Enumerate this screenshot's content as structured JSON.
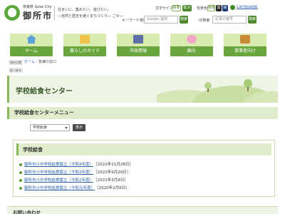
{
  "header": {
    "logo_sub": "奈良県 Gose City",
    "logo_city": "御所市",
    "tagline1": "住まいに、集めたい。遊びたい。",
    "tagline2": "―自然と歴史を継ぐまちづくり― ごせ―",
    "font_size_label": "文字サイズ",
    "font_size_standard": "標準",
    "font_size_large": "拡大",
    "bg_color_label": "背景色",
    "bg_standard": "標準",
    "bg_black": "黒",
    "bg_blue": "紺",
    "language": "Language",
    "keyword_search_label": "キーワード検索",
    "keyword_placeholder": "Google 提供",
    "keyword_search_button": "検索",
    "id_search_label": "ID検索",
    "id_placeholder": "記事の番号",
    "id_search_button": "検索"
  },
  "nav": {
    "items": [
      {
        "label": "ホーム",
        "icon": "home-icon"
      },
      {
        "label": "暮らしのガイド",
        "icon": "guide-icon"
      },
      {
        "label": "市政情報",
        "icon": "city-hall-icon"
      },
      {
        "label": "観光",
        "icon": "flower-icon"
      },
      {
        "label": "事業者向け",
        "icon": "briefcase-icon"
      }
    ]
  },
  "breadcrumb": {
    "tag1": "現在位置",
    "tag2": "前へ戻る",
    "home": "ホーム",
    "sep": " › ",
    "current": "各課の窓口"
  },
  "page": {
    "title": "学校給食センター"
  },
  "menu": {
    "header": "学校給食センターメニュー",
    "select_value": "学校給食",
    "display_button": "表示"
  },
  "section": {
    "title": "学校給食",
    "links": [
      {
        "text": "御所市小中学校給食献立（令和4年度）",
        "date": "［2022年11月28日］"
      },
      {
        "text": "御所市小中学校給食献立（令和3年度）",
        "date": "［2022年9月29日］"
      },
      {
        "text": "御所市小中学校給食献立（令和2年度）",
        "date": "［2021年3月4日］"
      },
      {
        "text": "御所市小中学校給食献立（令和元年度）",
        "date": "［2020年2月6日］"
      }
    ]
  },
  "footer": {
    "contact_heading": "お問い合わせ"
  },
  "colors": {
    "accent_green": "#6aa63e",
    "nav_bg": "#d8ecb0",
    "link_blue": "#2a5faa"
  }
}
